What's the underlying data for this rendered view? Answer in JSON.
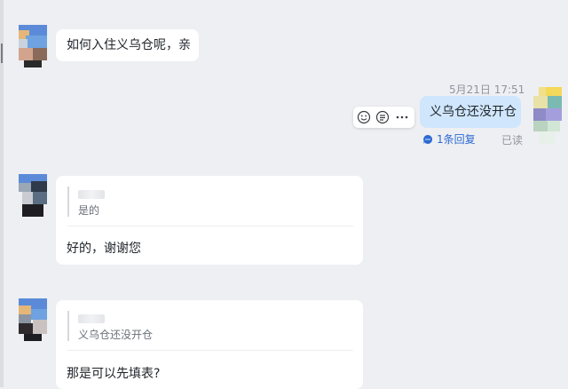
{
  "messages": {
    "m1": {
      "text": "如何入住义乌仓呢，亲"
    },
    "m2": {
      "timestamp": "5月21日 17:51",
      "text": "义乌仓还没开仓",
      "reply_count": "1条回复",
      "read_status": "已读"
    },
    "m3": {
      "quote": "是的",
      "text": "好的，谢谢您"
    },
    "m4": {
      "quote": "义乌仓还没开仓",
      "text": "那是可以先填表?"
    }
  },
  "colors": {
    "outgoing_bubble": "#cfe6fd",
    "link": "#2d6bd4",
    "background": "#eeeff2"
  },
  "icons": [
    "emoji-icon",
    "reply-icon",
    "more-icon",
    "reply-thread-icon"
  ]
}
